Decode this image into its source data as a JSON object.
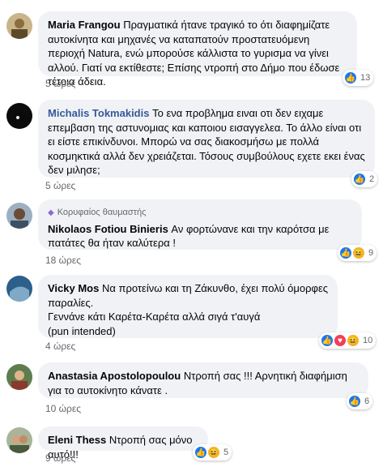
{
  "comments": [
    {
      "name": "Maria Frangou",
      "text": "Πραγματικά ήτανε τραγικό το ότι διαφημίζατε αυτοκίνητα και μηχανές να καταπατούν προστατευόμενη περιοχή Natura, ενώ μπορούσε κάλλιστα το γυρισμα να γίνει αλλού. Γιατί να εκτίθεστε; Επίσης ντροπή στο Δήμο που έδωσε τέτοια άδεια.",
      "time": "5 ώρες",
      "reaction_count": "13",
      "reactions": [
        "like-icon"
      ]
    },
    {
      "name": "Michalis Tokmakidis",
      "text": "Το ενα προβλημα ειναι οτι δεν ειχαμε επεμβαση της αστυνομιας και καποιου εισαγγελεα. Το άλλο είναι οτι ει είστε επικίνδυνοι. Μπορώ να σας διακοσμήσω με πολλά κοσμηκτικά αλλά δεν χρειάζεται. Τόσους συμβούλους εχετε εκει ένας δεν μιλησε;",
      "time": "5 ώρες",
      "reaction_count": "2",
      "reactions": [
        "like-icon"
      ]
    },
    {
      "badge": "Κορυφαίος θαυμαστής",
      "name": "Nikolaos Fotiou Binieris",
      "text": "Αν φορτώνανε και την καρότσα με πατάτες θα ήταν καλύτερα !",
      "time": "18 ώρες",
      "reaction_count": "9",
      "reactions": [
        "like-icon",
        "haha-icon"
      ]
    },
    {
      "name": "Vicky Mos",
      "text": "Να προτείνω και τη Ζάκυνθο, έχει πολύ όμορφες παραλίες.",
      "text2": "Γεννάνε κάτι Καρέτα-Καρέτα αλλά σιγά τ'αυγά",
      "text3": "(pun intended)",
      "time": "4 ώρες",
      "reaction_count": "10",
      "reactions": [
        "like-icon",
        "love-icon",
        "haha-icon"
      ]
    },
    {
      "name": "Anastasia Apostolopoulou",
      "text": "Ντροπή σας !!! Αρνητική διαφήμιση για το αυτοκίνητο κάνατε .",
      "time": "10 ώρες",
      "reaction_count": "6",
      "reactions": [
        "like-icon"
      ]
    },
    {
      "name": "Eleni Thess",
      "text": "Ντροπή σας μόνο αυτό!!!",
      "time": "9 ώρες",
      "reaction_count": "5",
      "reactions": [
        "like-icon",
        "haha-icon"
      ]
    }
  ],
  "colors": {
    "bubble_bg": "#f0f2f5",
    "like": "#1877f2",
    "love": "#f33e58",
    "haha": "#f7b125",
    "meta_text": "#65676b"
  }
}
